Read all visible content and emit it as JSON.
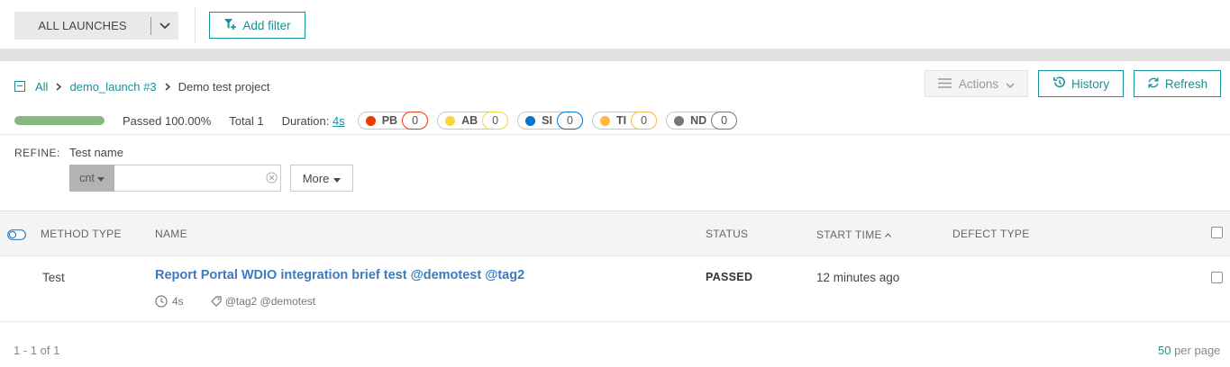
{
  "filter_bar": {
    "launch_select_label": "ALL LAUNCHES",
    "add_filter_label": "Add filter"
  },
  "breadcrumb": {
    "items": [
      "All",
      "demo_launch #3",
      "Demo test project"
    ]
  },
  "toolbar": {
    "actions_label": "Actions",
    "history_label": "History",
    "refresh_label": "Refresh"
  },
  "stats": {
    "passed_label": "Passed 100.00%",
    "passed_fraction": 1.0,
    "total_label": "Total 1",
    "duration_prefix": "Duration: ",
    "duration_value": "4s",
    "defects": [
      {
        "code": "PB",
        "count": "0",
        "color": "#ec3900",
        "border": "#ec3900"
      },
      {
        "code": "AB",
        "count": "0",
        "color": "#f7d63e",
        "border": "#f7d63e"
      },
      {
        "code": "SI",
        "count": "0",
        "color": "#0274d1",
        "border": "#0274d1"
      },
      {
        "code": "TI",
        "count": "0",
        "color": "#ffb743",
        "border": "#ffb743"
      },
      {
        "code": "ND",
        "count": "0",
        "color": "#777777",
        "border": "#777777"
      }
    ]
  },
  "refine": {
    "label": "REFINE:",
    "field_label": "Test name",
    "condition": "cnt",
    "input_value": "",
    "more_label": "More"
  },
  "table": {
    "headers": {
      "method_type": "METHOD TYPE",
      "name": "NAME",
      "status": "STATUS",
      "start_time": "START TIME",
      "defect_type": "DEFECT TYPE"
    },
    "rows": [
      {
        "method_type": "Test",
        "name": "Report Portal WDIO integration brief test @demotest @tag2",
        "duration": "4s",
        "tags": "@tag2 @demotest",
        "status": "PASSED",
        "start_time": "12 minutes ago"
      }
    ]
  },
  "pagination": {
    "range": "1 - 1 of 1",
    "per_page_num": "50",
    "per_page_suffix": " per page"
  },
  "colors": {
    "accent": "#179199",
    "link_blue": "#3c7bbf",
    "progress_pass": "#87b87f"
  }
}
